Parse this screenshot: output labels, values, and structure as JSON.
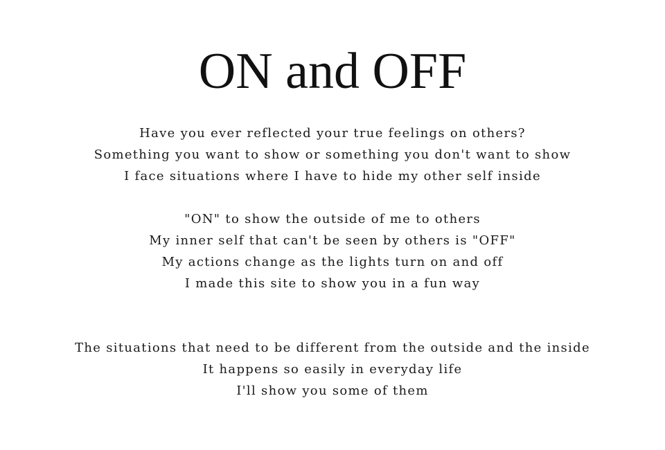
{
  "page": {
    "title": "ON and OFF",
    "stanzas": [
      {
        "lines": [
          "Have you ever reflected your true feelings on others?",
          "Something you want to show or something you don't want to show",
          "I face situations where I have to hide my other self inside"
        ]
      },
      {
        "lines": [
          "\"ON\" to show the outside of me to others",
          "My inner self that can't be seen by others is \"OFF\"",
          "My actions change as the lights turn on and off",
          "I made this site to show you in a fun way"
        ]
      },
      {
        "lines": [
          "The situations that need to be different from the outside and the inside",
          "It happens so easily in everyday life",
          "I'll show you some of them"
        ]
      }
    ]
  },
  "colors": {
    "background": "#ffffff",
    "text": "#111111"
  }
}
